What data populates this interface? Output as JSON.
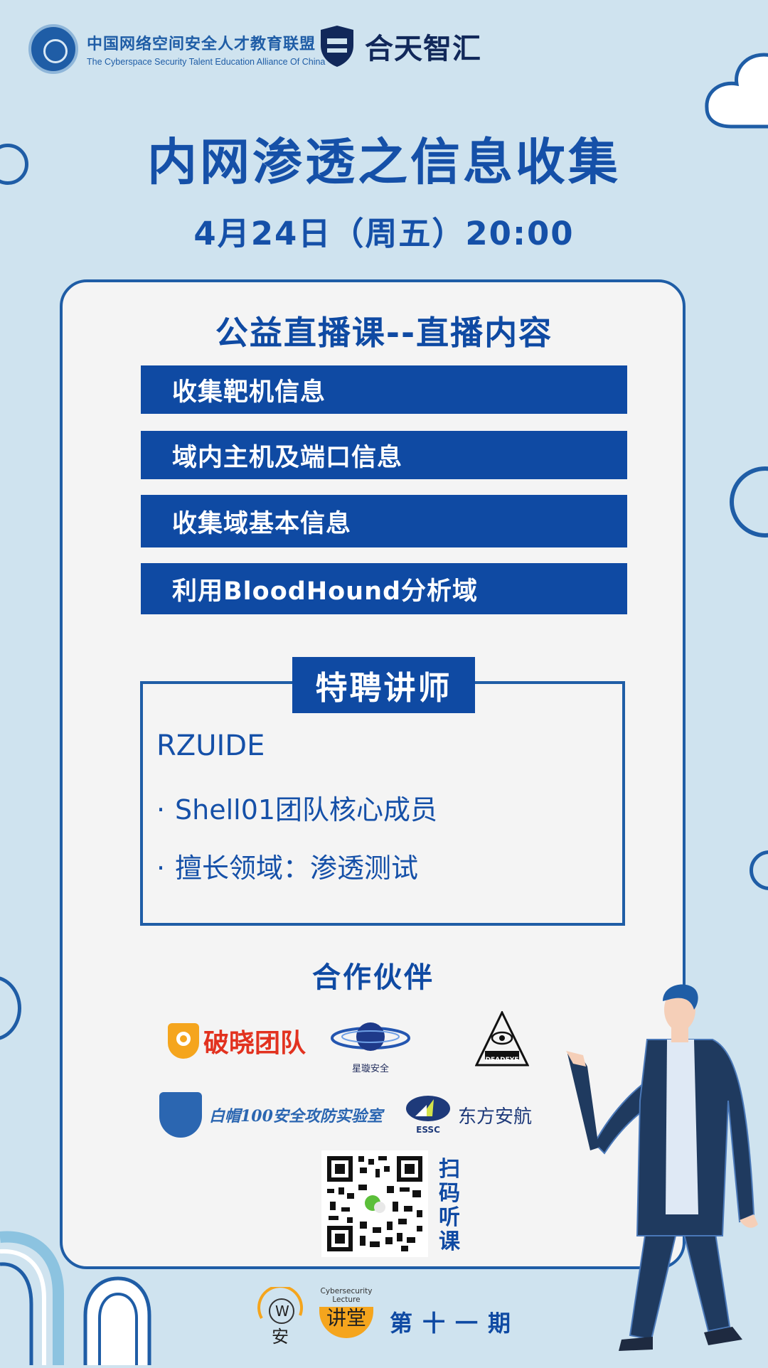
{
  "header": {
    "alliance_cn": "中国网络空间安全人才教育联盟",
    "alliance_en": "The Cyberspace Security Talent Education Alliance Of China",
    "partner_brand": "合天智汇"
  },
  "title": "内网渗透之信息收集",
  "datetime": "4月24日（周五）20:00",
  "course": {
    "heading": "公益直播课--直播内容",
    "topics": [
      "收集靶机信息",
      "域内主机及端口信息",
      "收集域基本信息",
      "利用BloodHound分析域"
    ]
  },
  "lecturer": {
    "tag": "特聘讲师",
    "name": "RZUIDE",
    "bullet": "·",
    "lines": [
      "Shell01团队核心成员",
      "擅长领域：渗透测试"
    ]
  },
  "partners": {
    "title": "合作伙伴",
    "logos": [
      "破晓团队",
      "星璇安全",
      "DEADEYE",
      "白帽100安全攻防实验室",
      "东方安航"
    ],
    "essc_label": "ESSC"
  },
  "qr": {
    "caption": "扫码听课"
  },
  "footer": {
    "w_logo_letter": "W",
    "w_logo_cn": "安",
    "lecture_en_1": "Cybersecurity",
    "lecture_en_2": "Lecture",
    "lecture_cn": "讲堂",
    "issue": "第十一期"
  },
  "colors": {
    "background": "#cfe3ef",
    "primary_blue": "#0f4aa3",
    "card_bg": "#f4f4f4",
    "accent_orange": "#f5a51d",
    "navy": "#1f3a5f"
  }
}
